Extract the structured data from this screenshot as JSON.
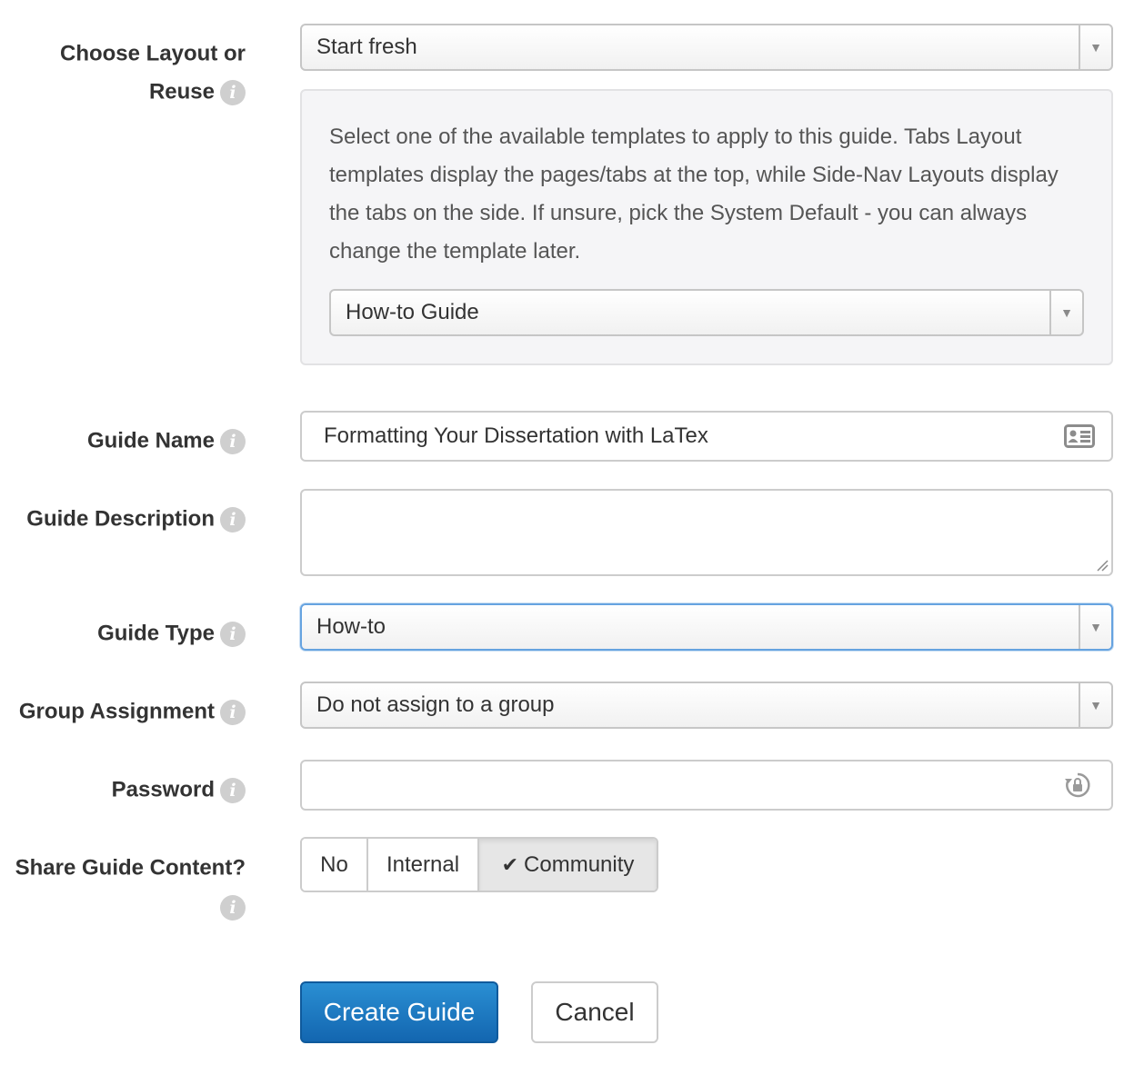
{
  "layout": {
    "label_line1": "Choose Layout or",
    "label_line2": "Reuse",
    "select_value": "Start fresh",
    "help_text": "Select one of the available templates to apply to this guide. Tabs Layout templates display the pages/tabs at the top, while Side-Nav Layouts display the tabs on the side. If unsure, pick the System Default - you can always change the template later.",
    "template_value": "How-to Guide"
  },
  "guide_name": {
    "label": "Guide Name",
    "value": "Formatting Your Dissertation with LaTex",
    "icon": "contact-card-icon"
  },
  "guide_description": {
    "label": "Guide Description",
    "value": ""
  },
  "guide_type": {
    "label": "Guide Type",
    "value": "How-to"
  },
  "group_assignment": {
    "label": "Group Assignment",
    "value": "Do not assign to a group"
  },
  "password": {
    "label": "Password",
    "value": "",
    "icon": "lock-refresh-icon"
  },
  "share": {
    "label": "Share Guide Content?",
    "options": [
      "No",
      "Internal",
      "Community"
    ],
    "selected": "Community"
  },
  "actions": {
    "create_label": "Create Guide",
    "cancel_label": "Cancel"
  },
  "colors": {
    "primary": "#1a7cc7",
    "focus": "#66a3e0",
    "info_icon": "#cfcfcf"
  },
  "info_glyph": "i",
  "caret_glyph": "▼",
  "check_glyph": "✔"
}
